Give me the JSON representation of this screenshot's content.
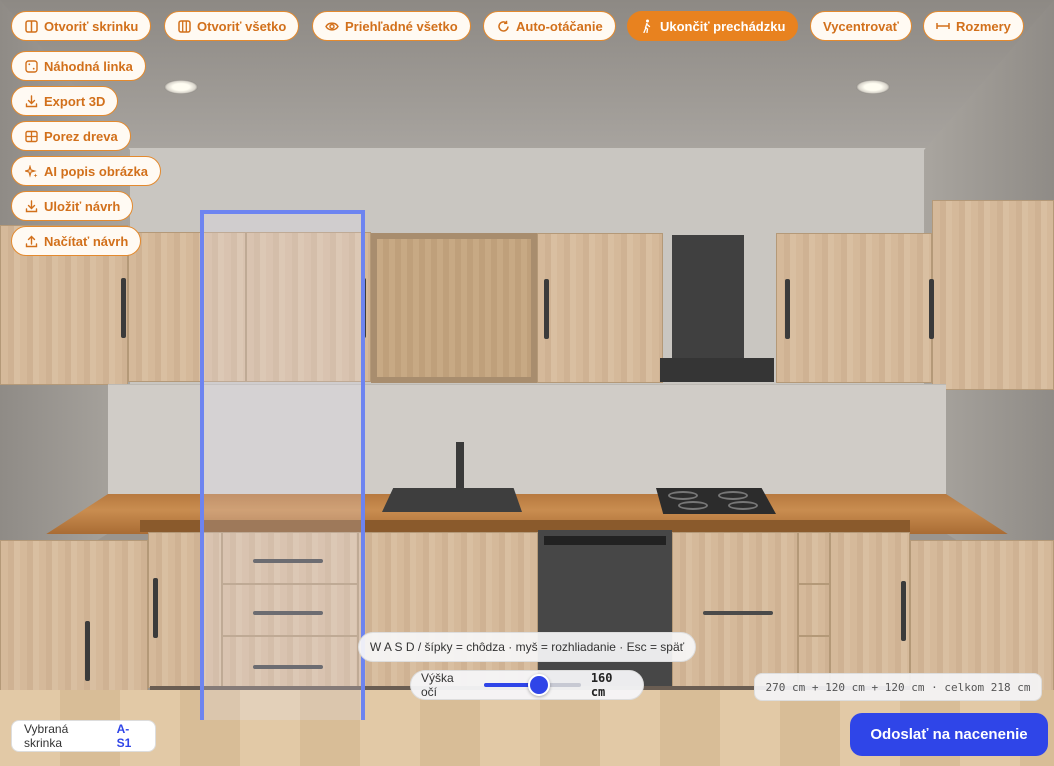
{
  "toolbar": {
    "top": [
      {
        "label": "Otvoriť skrinku",
        "icon": "door-icon"
      },
      {
        "label": "Otvoriť všetko",
        "icon": "columns-icon"
      },
      {
        "label": "Priehľadné všetko",
        "icon": "eye-icon"
      },
      {
        "label": "Auto-otáčanie",
        "icon": "rotate-icon"
      },
      {
        "label": "Ukončiť prechádzku",
        "icon": "walk-icon",
        "active": true
      },
      {
        "label": "Vycentrovať"
      },
      {
        "label": "Rozmery",
        "icon": "ruler-icon"
      }
    ],
    "side": [
      {
        "label": "Náhodná linka",
        "icon": "dice-icon"
      },
      {
        "label": "Export 3D",
        "icon": "download-icon"
      },
      {
        "label": "Porez dreva",
        "icon": "grid-icon"
      },
      {
        "label": "AI popis obrázka",
        "icon": "sparkle-icon"
      },
      {
        "label": "Uložiť návrh",
        "icon": "download-icon"
      },
      {
        "label": "Načítať návrh",
        "icon": "upload-icon"
      }
    ]
  },
  "hint": "W A S D / šípky = chôdza · myš = rozhliadanie · Esc = späť",
  "eye_height": {
    "label": "Výška očí",
    "value": "160 cm",
    "slider_fraction": 0.55
  },
  "dimensions": "270 cm + 120 cm + 120 cm · celkom 218 cm",
  "selected": {
    "label": "Vybraná skrinka",
    "code": "A-S1"
  },
  "submit": "Odoslať na nacenenie",
  "colors": {
    "accent": "#e8821f",
    "primary": "#2f45e8",
    "selection": "#6d84f0"
  }
}
